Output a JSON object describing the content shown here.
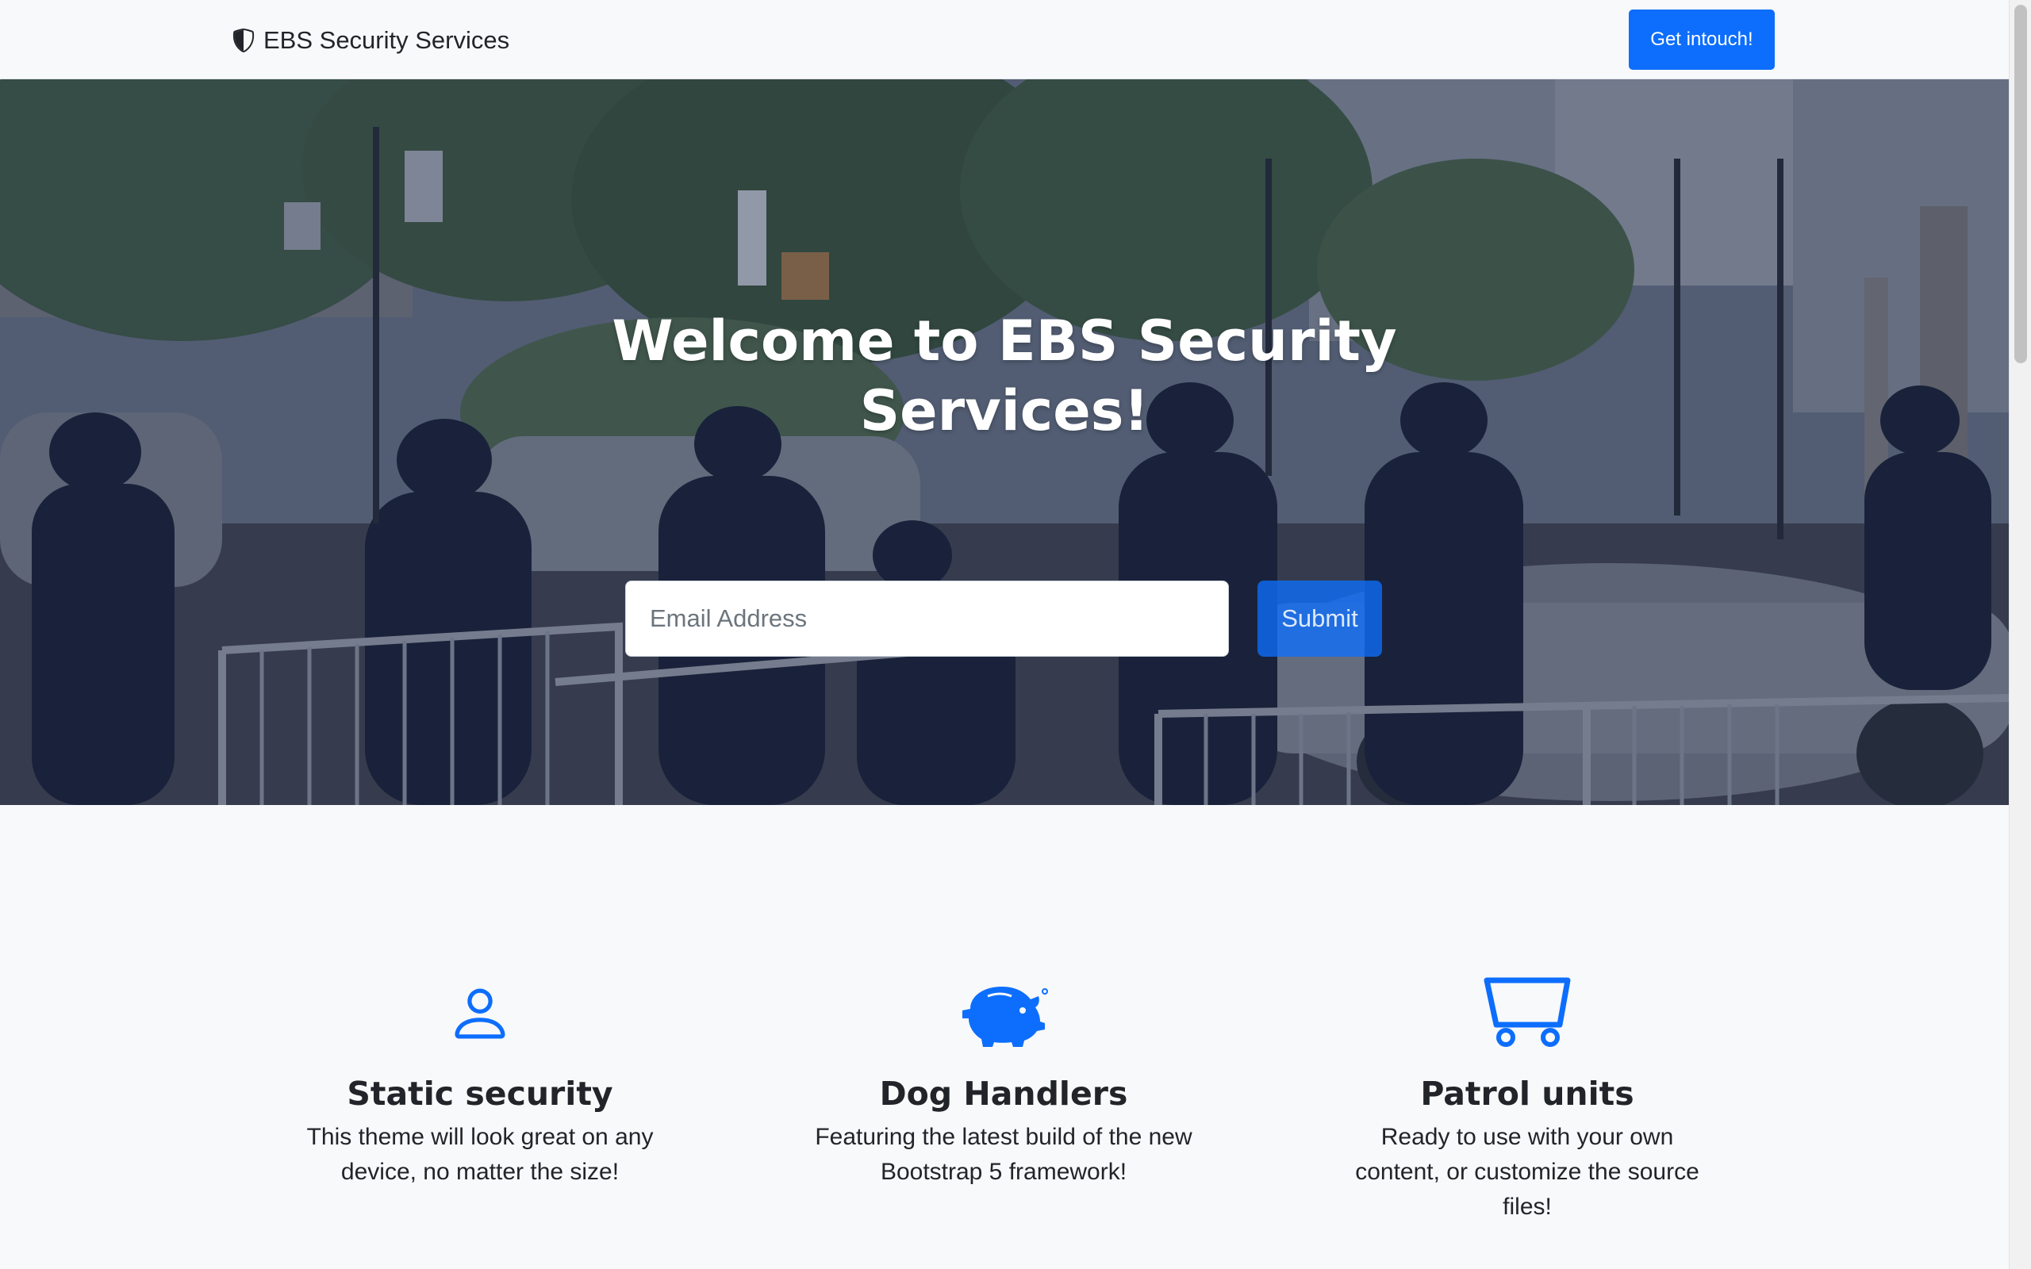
{
  "navbar": {
    "brand_icon": "shield-half-icon",
    "brand": "EBS Security Services",
    "contact_button": "Get intouch!"
  },
  "hero": {
    "title": "Welcome to EBS Security Services!",
    "email_placeholder": "Email Address",
    "submit_label": "Submit",
    "background": "street photo of police officers behind metal barricades"
  },
  "features": [
    {
      "icon": "person-icon",
      "title": "Static security",
      "text": "This theme will look great on any device, no matter the size!"
    },
    {
      "icon": "piggy-bank-icon",
      "title": "Dog Handlers",
      "text": "Featuring the latest build of the new Bootstrap 5 framework!"
    },
    {
      "icon": "cart-icon",
      "title": "Patrol units",
      "text": "Ready to use with your own content, or customize the source files!"
    }
  ],
  "colors": {
    "primary": "#0d6efd",
    "page_background": "#f8f9fa",
    "text": "#212529"
  }
}
